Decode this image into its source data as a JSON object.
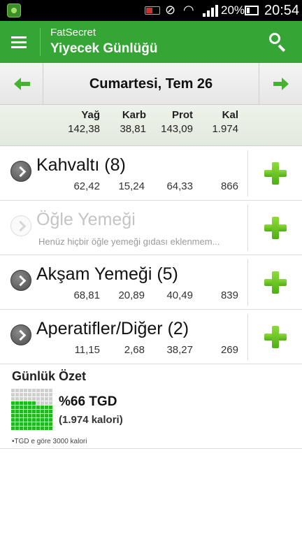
{
  "status_bar": {
    "time": "20:54",
    "battery_percent": "20%",
    "icons": [
      "app-notification-icon",
      "battery-low-icon",
      "vibrate-icon",
      "wifi-icon",
      "signal-icon",
      "battery-icon"
    ]
  },
  "header": {
    "app_name": "FatSecret",
    "title": "Yiyecek Günlüğü",
    "icons": [
      "menu-icon",
      "search-icon"
    ],
    "color": "#35a535"
  },
  "date_nav": {
    "date": "Cumartesi, Tem 26",
    "icons": [
      "arrow-left-icon",
      "arrow-right-icon"
    ]
  },
  "totals": {
    "columns": [
      {
        "label": "Yağ",
        "value": "142,38"
      },
      {
        "label": "Karb",
        "value": "38,81"
      },
      {
        "label": "Prot",
        "value": "143,09"
      },
      {
        "label": "Kal",
        "value": "1.974"
      }
    ]
  },
  "meals": [
    {
      "title": "Kahvaltı (8)",
      "fat": "62,42",
      "carb": "15,24",
      "prot": "64,33",
      "kcal": "866"
    },
    {
      "title": "Öğle Yemeği",
      "note": "Henüz hiçbir öğle yemeği gıdası eklenmem..."
    },
    {
      "title": "Akşam Yemeği (5)",
      "fat": "68,81",
      "carb": "20,89",
      "prot": "40,49",
      "kcal": "839"
    },
    {
      "title": "Aperatifler/Diğer (2)",
      "fat": "11,15",
      "carb": "2,68",
      "prot": "38,27",
      "kcal": "269"
    }
  ],
  "summary": {
    "title": "Günlük Özet",
    "percent_label": "%66 TGD",
    "calories_label": "(1.974 kalori)",
    "footnote": "•TGD e göre 3000 kalori",
    "rdi_fraction": 0.66,
    "filled_color": "#22b822",
    "empty_color": "#cfcfcf"
  }
}
